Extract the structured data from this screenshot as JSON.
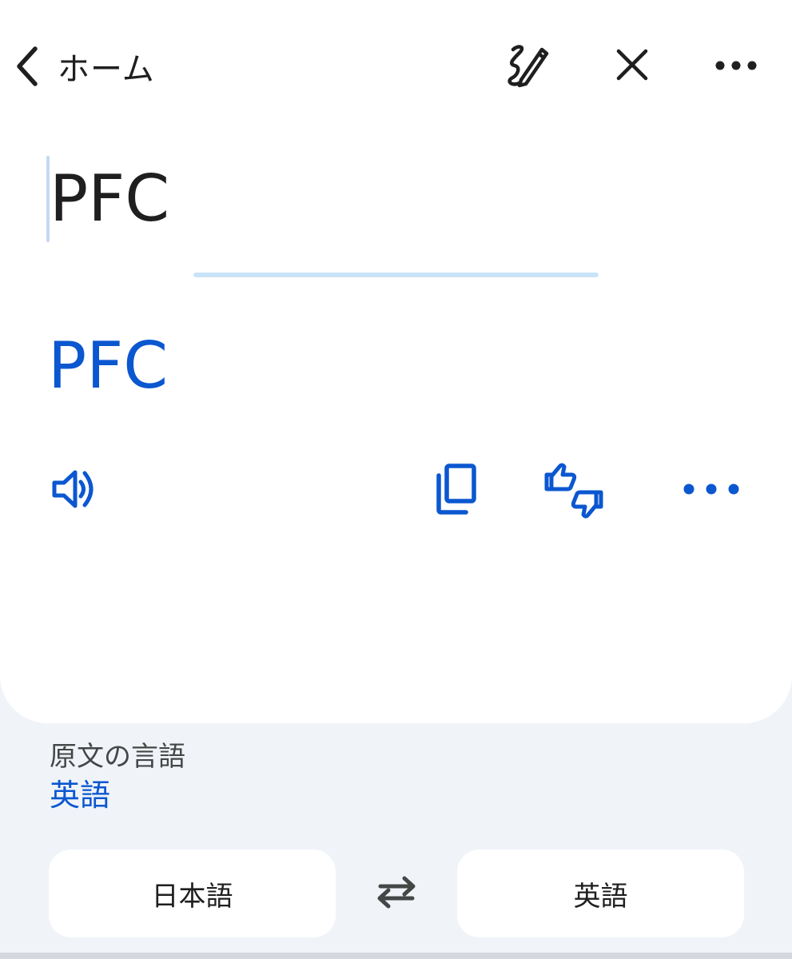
{
  "header": {
    "back_label": "ホーム",
    "icons": [
      "back-chevron-icon",
      "handwriting-icon",
      "close-icon",
      "more-options-icon"
    ]
  },
  "input": {
    "source_text": "PFC"
  },
  "output": {
    "translated_text": "PFC",
    "actions": [
      "speaker-icon",
      "copy-icon",
      "feedback-thumbs-icon",
      "more-options-icon"
    ]
  },
  "language_detect": {
    "caption": "原文の言語",
    "value": "英語"
  },
  "language_bar": {
    "source_language": "日本語",
    "target_language": "英語",
    "swap_icon": "swap-arrows-icon"
  },
  "colors": {
    "accent": "#0b57d0",
    "text": "#1f1f1f",
    "secondary_text": "#444746",
    "page_background": "#f0f4f9",
    "card_background": "#ffffff",
    "divider": "#c9e4f9"
  }
}
